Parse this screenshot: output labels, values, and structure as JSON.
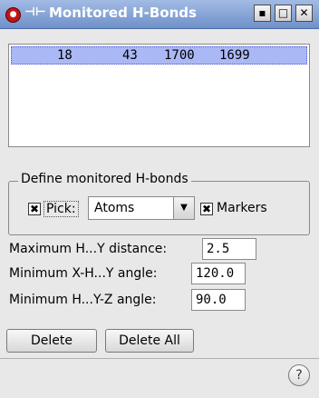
{
  "window": {
    "title": "Monitored H-Bonds",
    "buttons": {
      "minimize": "▪",
      "maximize": "□",
      "close": "✕"
    }
  },
  "monitored_list": {
    "rows": [
      {
        "cells": [
          "18",
          "43",
          "1700",
          "1699"
        ],
        "selected": true
      }
    ]
  },
  "define_group": {
    "title": "Define monitored H-bonds",
    "pick_checkbox": {
      "label": "Pick:",
      "checked": true
    },
    "pick_mode": {
      "value": "Atoms"
    },
    "markers_checkbox": {
      "label": "Markers",
      "checked": true
    }
  },
  "criteria": {
    "max_distance": {
      "label": "Maximum H...Y distance:",
      "value": "2.5"
    },
    "min_xhy_angle": {
      "label": "Minimum X-H...Y angle:",
      "value": "120.0"
    },
    "min_hyz_angle": {
      "label": "Minimum H...Y-Z angle:",
      "value": "90.0"
    }
  },
  "actions": {
    "delete_label": "Delete",
    "delete_all_label": "Delete All",
    "help_label": "?"
  },
  "icons": {
    "window_menu": "window-menu-icon",
    "pin": "pin-icon",
    "dropdown": "chevron-down-icon",
    "check": "check-icon"
  },
  "colors": {
    "titlebar": "#6f90c8",
    "selection": "#aab8f5",
    "window_bg": "#e8e8e8"
  }
}
